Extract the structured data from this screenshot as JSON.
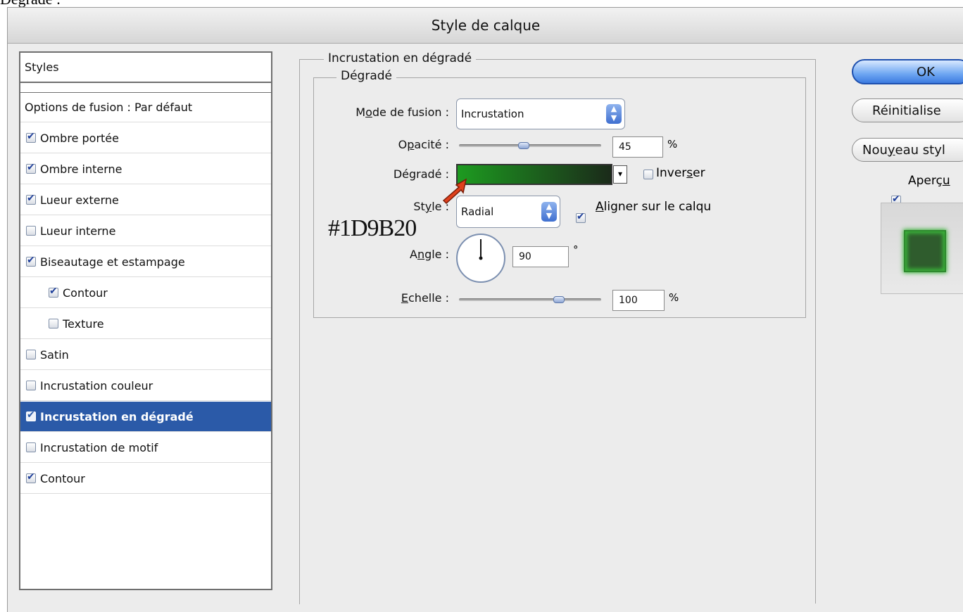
{
  "caption_partial": "Dégradé :",
  "dialog": {
    "title": "Style de calque"
  },
  "styles_panel": {
    "header": "Styles",
    "blend_options": "Options de fusion : Par défaut",
    "items": [
      {
        "label": "Ombre portée",
        "checked": true,
        "indent": false,
        "selected": false
      },
      {
        "label": "Ombre interne",
        "checked": true,
        "indent": false,
        "selected": false
      },
      {
        "label": "Lueur externe",
        "checked": true,
        "indent": false,
        "selected": false
      },
      {
        "label": "Lueur interne",
        "checked": false,
        "indent": false,
        "selected": false
      },
      {
        "label": "Biseautage et estampage",
        "checked": true,
        "indent": false,
        "selected": false
      },
      {
        "label": "Contour",
        "checked": true,
        "indent": true,
        "selected": false
      },
      {
        "label": "Texture",
        "checked": false,
        "indent": true,
        "selected": false
      },
      {
        "label": "Satin",
        "checked": false,
        "indent": false,
        "selected": false
      },
      {
        "label": "Incrustation couleur",
        "checked": false,
        "indent": false,
        "selected": false
      },
      {
        "label": "Incrustation en dégradé",
        "checked": true,
        "indent": false,
        "selected": true
      },
      {
        "label": "Incrustation de motif",
        "checked": false,
        "indent": false,
        "selected": false
      },
      {
        "label": "Contour",
        "checked": true,
        "indent": false,
        "selected": false
      }
    ]
  },
  "gradient_overlay": {
    "section_title": "Incrustation en dégradé",
    "group_title": "Dégradé",
    "blend_mode": {
      "label_pre": "M",
      "label_u": "o",
      "label_post": "de de fusion :",
      "value": "Incrustation"
    },
    "opacity": {
      "label_pre": "O",
      "label_u": "p",
      "label_post": "acité :",
      "value": "45",
      "unit": "%",
      "fraction": 0.45
    },
    "gradient": {
      "label": "Dégradé :",
      "color_start": "#1D9B20",
      "color_end": "#1b2a1a",
      "reverse_pre": "Inver",
      "reverse_u": "s",
      "reverse_post": "er",
      "reverse_checked": false
    },
    "style": {
      "label_pre": "St",
      "label_u": "y",
      "label_post": "le :",
      "value": "Radial",
      "align_u": "A",
      "align_post": "ligner sur le calqu",
      "align_checked": true
    },
    "angle": {
      "label_pre": "A",
      "label_u": "n",
      "label_post": "gle :",
      "value": "90",
      "unit": "°"
    },
    "scale": {
      "label_u": "E",
      "label_post": "chelle :",
      "value": "100",
      "unit": "%",
      "fraction": 0.7
    },
    "hex_note": "#1D9B20"
  },
  "buttons": {
    "ok": "OK",
    "reset": "Réinitialise",
    "new_style_pre": "Nou",
    "new_style_u": "y",
    "new_style_post": "eau styl",
    "preview_pre": "Aperç",
    "preview_u": "u",
    "preview_checked": true
  },
  "colors": {
    "selection": "#2b5aa8",
    "gradient_start": "#1D9B20",
    "pointer_arrow": "#e0401c"
  }
}
